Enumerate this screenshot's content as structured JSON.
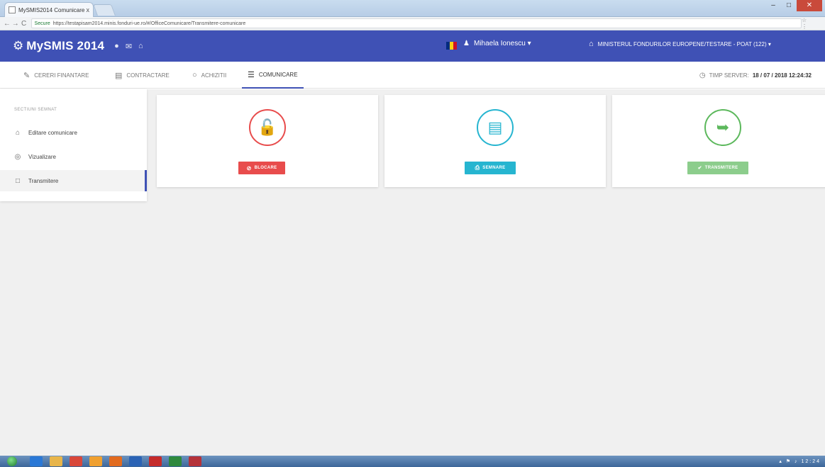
{
  "browser": {
    "tab_title": "MySMIS2014 Comunicare",
    "tab_close": "x",
    "url_secure": "Secure",
    "url": "https://testapisam2014.minis.fonduri-ue.ro/#/OfficeComunicare/Transmitere-comunicare",
    "nav_back": "←",
    "nav_forward": "→",
    "nav_reload": "C",
    "addr_icons": "☆ ⋮",
    "win_min": "–",
    "win_max": "□",
    "win_close": "✕"
  },
  "header": {
    "brand": "MySMIS 2014",
    "brand_icon": "gear-icon",
    "icons": [
      "●",
      "✉",
      "⌂"
    ],
    "flag_colors": [
      "#002b7f",
      "#fcd116",
      "#ce1126"
    ],
    "user_icon": "♟",
    "user_name": "Mihaela Ionescu ▾",
    "institution_icon": "⌂",
    "institution": "MINISTERUL FONDURILOR EUROPENE/TESTARE - POAT (122) ▾",
    "bg_color": "#3f51b5"
  },
  "topnav": {
    "items": [
      {
        "icon": "✎",
        "label": "CERERI FINANTARE"
      },
      {
        "icon": "▤",
        "label": "CONTRACTARE"
      },
      {
        "icon": "○",
        "label": "ACHIZITII"
      },
      {
        "icon": "☰",
        "label": "COMUNICARE"
      }
    ],
    "server_time_icon": "◷",
    "server_time_label": "TIMP SERVER:",
    "server_time_value": "18 / 07 / 2018 12:24:32"
  },
  "sidebar": {
    "heading": "SECTIUNI SEMNAT",
    "items": [
      {
        "icon": "⌂",
        "label": "Editare comunicare"
      },
      {
        "icon": "◎",
        "label": "Vizualizare"
      },
      {
        "icon": "□",
        "label": "Transmitere"
      }
    ]
  },
  "cards": [
    {
      "icon": "🔓",
      "icon_name": "unlock-icon",
      "button_icon": "⊘",
      "button_label": "BLOCARE",
      "color": "#e84c4c"
    },
    {
      "icon": "▤",
      "icon_name": "pdf-document-icon",
      "button_icon": "⎙",
      "button_label": "SEMNARE",
      "color": "#26b5d0"
    },
    {
      "icon": "➥",
      "icon_name": "forward-arrow-icon",
      "button_icon": "✔",
      "button_label": "TRANSMITERE",
      "color": "#5cb85c"
    }
  ],
  "taskbar": {
    "tray": "▴ ⚑ ♪ 12:24"
  }
}
